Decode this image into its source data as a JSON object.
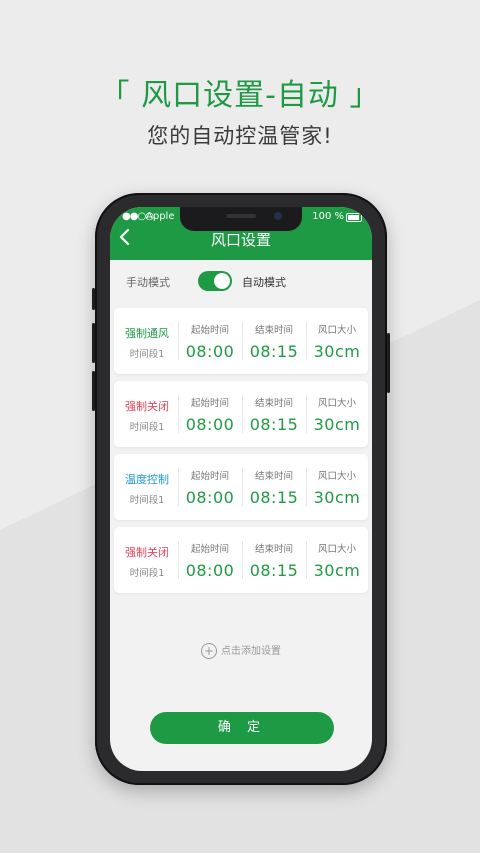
{
  "headline": "「 风口设置-自动 」",
  "subline": "您的自动控温管家!",
  "status_bar": {
    "carrier": "Apple",
    "battery": "100 %"
  },
  "header": {
    "title": "风口设置"
  },
  "mode_switch": {
    "manual_label": "手动模式",
    "auto_label": "自动模式",
    "auto_enabled": true
  },
  "cards": [
    {
      "mode": "强制通风",
      "mode_color": "#1f9a44",
      "period": "时间段1",
      "start_label": "起始时间",
      "start": "08:00",
      "end_label": "结束时间",
      "end": "08:15",
      "size_label": "风口大小",
      "size": "30cm"
    },
    {
      "mode": "强制关闭",
      "mode_color": "#e0445a",
      "period": "时间段1",
      "start_label": "起始时间",
      "start": "08:00",
      "end_label": "结束时间",
      "end": "08:15",
      "size_label": "风口大小",
      "size": "30cm"
    },
    {
      "mode": "温度控制",
      "mode_color": "#1a9bd7",
      "period": "时间段1",
      "start_label": "起始时间",
      "start": "08:00",
      "end_label": "结束时间",
      "end": "08:15",
      "size_label": "风口大小",
      "size": "30cm"
    },
    {
      "mode": "强制关闭",
      "mode_color": "#e0445a",
      "period": "时间段1",
      "start_label": "起始时间",
      "start": "08:00",
      "end_label": "结束时间",
      "end": "08:15",
      "size_label": "风口大小",
      "size": "30cm"
    }
  ],
  "add_label": "点击添加设置",
  "confirm_label": "确 定",
  "colors": {
    "accent": "#1f9a44",
    "background": "#ececec"
  }
}
